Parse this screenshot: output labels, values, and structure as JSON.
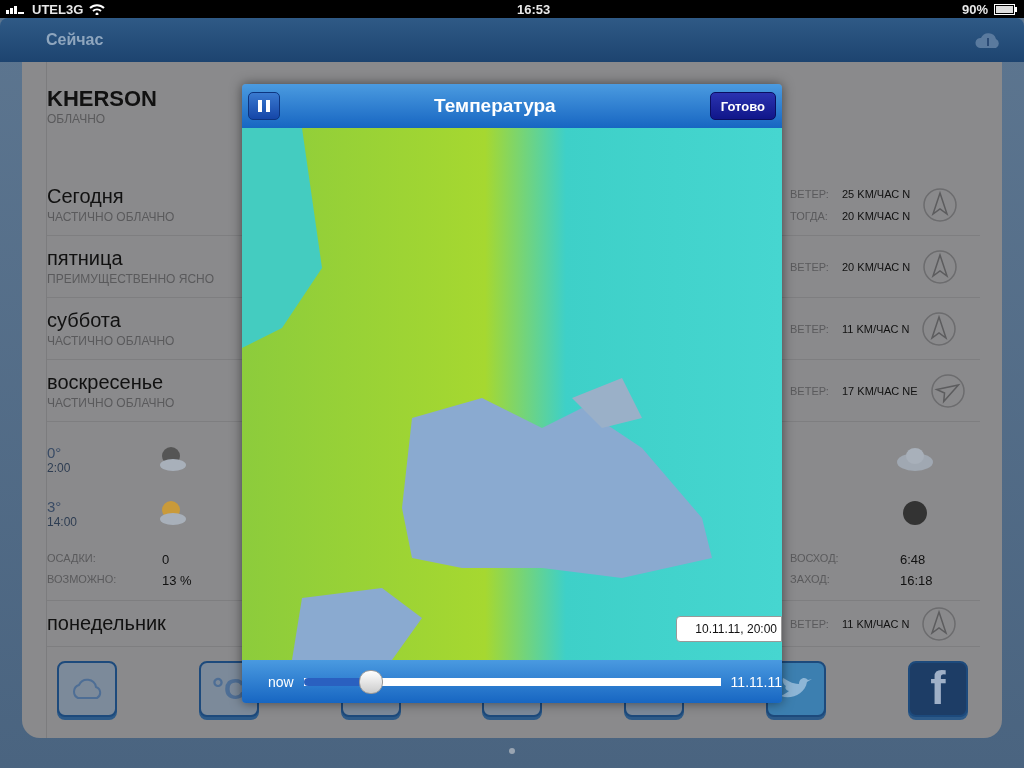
{
  "status_bar": {
    "carrier": "UTEL3G",
    "time": "16:53",
    "battery": "90%"
  },
  "header": {
    "title": "Сейчас"
  },
  "location": {
    "city": "KHERSON",
    "condition": "ОБЛАЧНО"
  },
  "days": [
    {
      "name": "Сегодня",
      "condition": "ЧАСТИЧНО ОБЛАЧНО",
      "wind": [
        {
          "label": "ВЕТЕР:",
          "value": "25 KM/ЧАС N"
        },
        {
          "label": "ТОГДА:",
          "value": "20 KM/ЧАС N"
        }
      ],
      "compass": {
        "kind": "n"
      }
    },
    {
      "name": "пятница",
      "condition": "ПРЕИМУЩЕСТВЕННО ЯСНО",
      "wind": [
        {
          "label": "ВЕТЕР:",
          "value": "20 KM/ЧАС N"
        }
      ],
      "compass": {
        "kind": "n"
      }
    },
    {
      "name": "суббота",
      "condition": "ЧАСТИЧНО ОБЛАЧНО",
      "wind": [
        {
          "label": "ВЕТЕР:",
          "value": "11 KM/ЧАС N"
        }
      ],
      "compass": {
        "kind": "n"
      }
    },
    {
      "name": "воскресенье",
      "condition": "ЧАСТИЧНО ОБЛАЧНО",
      "wind": [
        {
          "label": "ВЕТЕР:",
          "value": "17 KM/ЧАС NE"
        }
      ],
      "compass": {
        "kind": "ne"
      }
    }
  ],
  "details": {
    "hours": [
      {
        "temp": "0°",
        "time": "2:00",
        "left_icon": {
          "kind": "night"
        },
        "right_icon": {
          "kind": "cloud"
        }
      },
      {
        "temp": "3°",
        "time": "14:00",
        "left_icon": {
          "kind": "day"
        },
        "right_icon": {
          "kind": "moon"
        }
      }
    ],
    "precipitation": [
      {
        "label": "ОСАДКИ:",
        "value": "0"
      },
      {
        "label": "ВОЗМОЖНО:",
        "value": "13 %"
      }
    ],
    "sun": [
      {
        "label": "ВОСХОД:",
        "value": "6:48"
      },
      {
        "label": "ЗАХОД:",
        "value": "16:18"
      }
    ]
  },
  "more_days": [
    {
      "name": "понедельник",
      "wind": [
        {
          "label": "ВЕТЕР:",
          "value": "11 KM/ЧАС N"
        }
      ],
      "compass": {
        "kind": "n"
      }
    }
  ],
  "toolbar": [
    {
      "kind": "cloud"
    },
    {
      "kind": "celsius",
      "label": "°C"
    },
    {
      "kind": "blank"
    },
    {
      "kind": "blank"
    },
    {
      "kind": "blank"
    },
    {
      "kind": "twitter"
    },
    {
      "kind": "facebook",
      "label": "f"
    }
  ],
  "modal": {
    "title": "Температура",
    "done": "Готово",
    "timestamp": "10.11.11, 20:00",
    "slider": {
      "start": "now",
      "end": "11.11.11",
      "level": 0.16
    }
  }
}
